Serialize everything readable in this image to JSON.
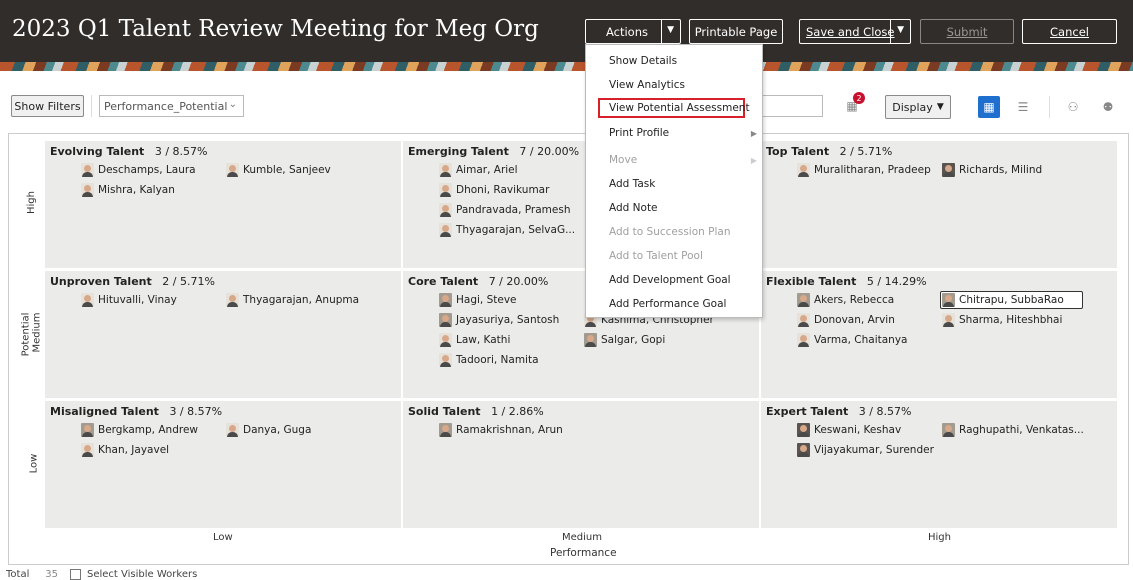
{
  "header": {
    "title": "2023 Q1 Talent Review Meeting for Meg Org",
    "actions_label": "Actions",
    "printable_label": "Printable Page",
    "save_close_label": "Save and Close",
    "submit_label": "Submit",
    "cancel_label": "Cancel"
  },
  "toolbar": {
    "show_filters": "Show Filters",
    "layout_select": "Performance_Potential",
    "notification_count": "2",
    "display_label": "Display"
  },
  "actions_menu": {
    "items": [
      {
        "label": "Show Details",
        "enabled": true
      },
      {
        "label": "View Analytics",
        "enabled": true
      },
      {
        "label": "View Potential Assessment",
        "enabled": true,
        "highlighted": true
      },
      {
        "label": "Print Profile",
        "enabled": true,
        "submenu": true
      },
      {
        "label": "Move",
        "enabled": false,
        "submenu": true
      },
      {
        "label": "Add Task",
        "enabled": true
      },
      {
        "label": "Add Note",
        "enabled": true
      },
      {
        "label": "Add to Succession Plan",
        "enabled": false
      },
      {
        "label": "Add to Talent Pool",
        "enabled": false
      },
      {
        "label": "Add Development Goal",
        "enabled": true
      },
      {
        "label": "Add Performance Goal",
        "enabled": true
      }
    ]
  },
  "grid": {
    "y_axis_label": "Potential",
    "x_axis_label": "Performance",
    "y_levels": [
      "High",
      "Medium",
      "Low"
    ],
    "x_levels": [
      "Low",
      "Medium",
      "High"
    ],
    "boxes": [
      {
        "name": "Evolving Talent",
        "stat": "3 / 8.57%",
        "workers": [
          "Deschamps, Laura",
          "Kumble, Sanjeev",
          "Mishra, Kalyan"
        ]
      },
      {
        "name": "Emerging Talent",
        "stat": "7 / 20.00%",
        "workers": [
          "Aimar, Ariel",
          "Dhoni, Ravikumar",
          "Pandravada, Pramesh",
          "Thyagarajan, SelvaG..."
        ]
      },
      {
        "name": "Top Talent",
        "stat": "2 / 5.71%",
        "workers": [
          "Muralitharan, Pradeep",
          "Richards, Milind"
        ]
      },
      {
        "name": "Unproven Talent",
        "stat": "2 / 5.71%",
        "workers": [
          "Hituvalli, Vinay",
          "Thyagarajan, Anupma"
        ]
      },
      {
        "name": "Core Talent",
        "stat": "7 / 20.00%",
        "workers": [
          "Hagi, Steve",
          "Jayasuriya, Santosh",
          "Kashima, Christopher",
          "Law, Kathi",
          "Salgar, Gopi",
          "Tadoori, Namita"
        ]
      },
      {
        "name": "Flexible Talent",
        "stat": "5 / 14.29%",
        "workers": [
          "Akers, Rebecca",
          "Chitrapu, SubbaRao",
          "Donovan, Arvin",
          "Sharma, Hiteshbhai",
          "Varma, Chaitanya"
        ]
      },
      {
        "name": "Misaligned Talent",
        "stat": "3 / 8.57%",
        "workers": [
          "Bergkamp, Andrew",
          "Danya, Guga",
          "Khan, Jayavel"
        ]
      },
      {
        "name": "Solid Talent",
        "stat": "1 / 2.86%",
        "workers": [
          "Ramakrishnan, Arun"
        ]
      },
      {
        "name": "Expert Talent",
        "stat": "3 / 8.57%",
        "workers": [
          "Keswani, Keshav",
          "Raghupathi, Venkatas...",
          "Vijayakumar, Surender"
        ]
      }
    ]
  },
  "footer": {
    "total_label": "Total",
    "total_value": "35",
    "select_visible": "Select Visible Workers"
  }
}
